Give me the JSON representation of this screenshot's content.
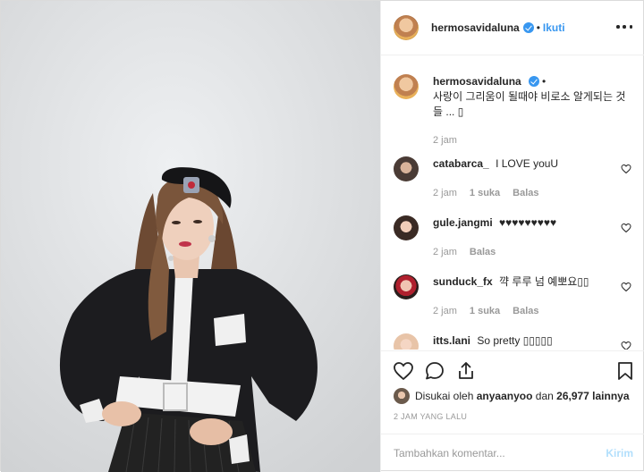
{
  "post": {
    "author": "hermosavidaluna",
    "follow_label": "Ikuti",
    "dot": "•"
  },
  "caption": {
    "user": "hermosavidaluna",
    "dot": "•",
    "text": "사랑이 그리움이 될때야 비로소 알게되는 것들 ... ▯",
    "time": "2 jam"
  },
  "comments": [
    {
      "user": "catabarca_",
      "text": "I LOVE youU",
      "time": "2 jam",
      "likes": "1 suka",
      "reply": "Balas"
    },
    {
      "user": "gule.jangmi",
      "text": "♥♥♥♥♥♥♥♥♥",
      "time": "2 jam",
      "likes": "",
      "reply": "Balas"
    },
    {
      "user": "sunduck_fx",
      "text": "꺅 루루 넘 예뽀요▯▯",
      "time": "2 jam",
      "likes": "1 suka",
      "reply": "Balas"
    },
    {
      "user": "itts.lani",
      "text": "So pretty ▯▯▯▯▯",
      "time": "",
      "likes": "",
      "reply": ""
    }
  ],
  "likes": {
    "prefix": "Disukai oleh",
    "user": "anyaanyoo",
    "conj": "dan",
    "count": "26,977 lainnya"
  },
  "timestamp": "2 JAM YANG LALU",
  "add_comment": {
    "placeholder": "Tambahkan komentar...",
    "post_label": "Kirim"
  },
  "colors": {
    "accent": "#3897f0",
    "post_disabled": "#b2dffc",
    "muted": "#999999"
  },
  "icons": {
    "like": "heart-icon",
    "comment": "comment-icon",
    "share": "share-icon",
    "save": "bookmark-icon",
    "more": "more-icon"
  }
}
